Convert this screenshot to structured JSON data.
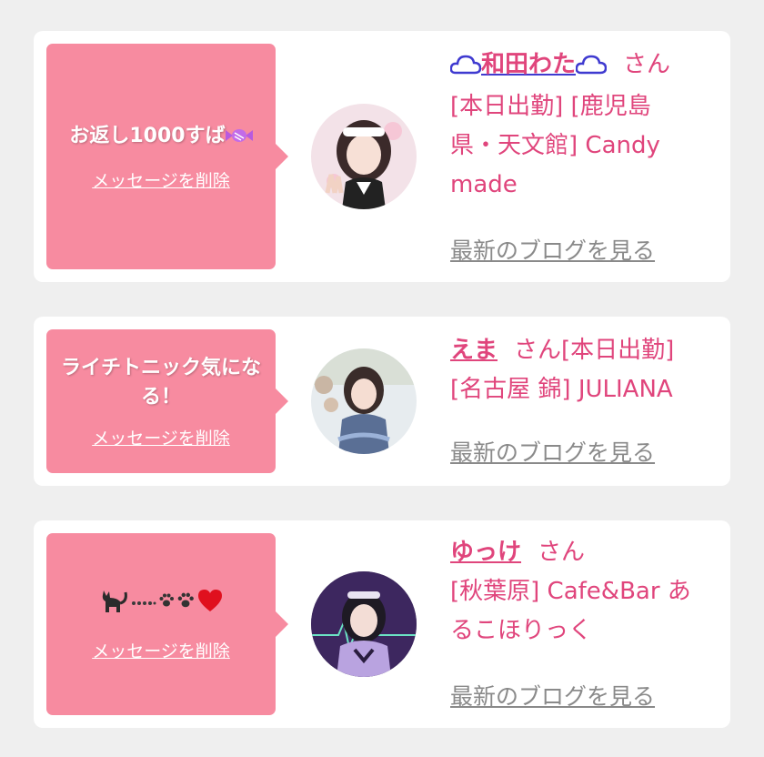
{
  "colors": {
    "bubble": "#f78ba0",
    "accent": "#e0457c",
    "link_gray": "#8a8a8a",
    "name_blue": "#3f3ad0"
  },
  "cards": [
    {
      "message": "お返し1000すば",
      "delete_label": "メッセージを削除",
      "name": "和田わた",
      "honorific": "さん",
      "details": "[本日出勤] [鹿児島県・天文館] Candy made",
      "blog_link": "最新のブログを見る"
    },
    {
      "message": "ライチトニック気になる！",
      "delete_label": "メッセージを削除",
      "name": "えま",
      "honorific": "さん[本日出勤]",
      "details": "[名古屋 錦] JULIANA",
      "blog_link": "最新のブログを見る"
    },
    {
      "message": "",
      "delete_label": "メッセージを削除",
      "name": "ゆっけ",
      "honorific": "さん",
      "details": "[秋葉原] Cafe&Bar あるこほりっく",
      "blog_link": "最新のブログを見る"
    }
  ]
}
